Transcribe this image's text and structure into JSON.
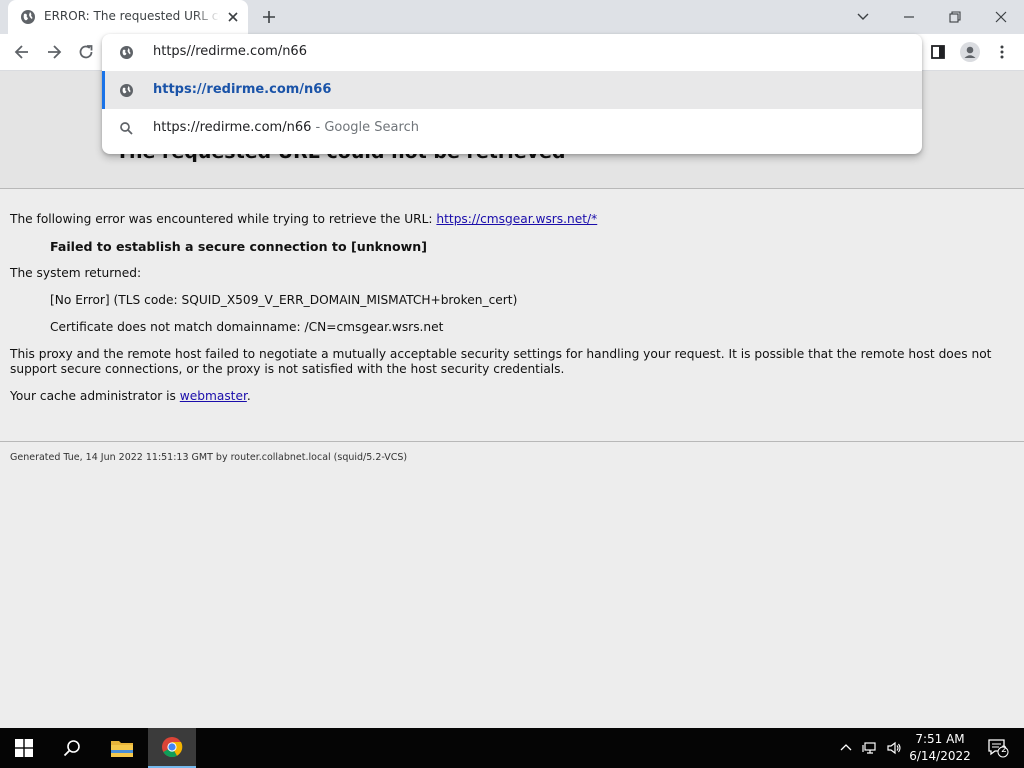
{
  "browser": {
    "tab_title": "ERROR: The requested URL could not be retrieved",
    "address_text": "https//redirme.com/n66",
    "suggestions": [
      {
        "text": "https://redirme.com/n66",
        "desc": "",
        "icon": "globe-icon"
      },
      {
        "text": "https://redirme.com/n66",
        "desc": " - Google Search",
        "icon": "search-icon"
      }
    ]
  },
  "page": {
    "heading": "The requested URL could not be retrieved",
    "intro": "The following error was encountered while trying to retrieve the URL: ",
    "url_link": "https://cmsgear.wsrs.net/*",
    "error_title": "Failed to establish a secure connection to [unknown]",
    "system_returned": "The system returned:",
    "tls_error": "[No Error] (TLS code: SQUID_X509_V_ERR_DOMAIN_MISMATCH+broken_cert)",
    "cert_error": "Certificate does not match domainname: /CN=cmsgear.wsrs.net",
    "explanation": "This proxy and the remote host failed to negotiate a mutually acceptable security settings for handling your request. It is possible that the remote host does not support secure connections, or the proxy is not satisfied with the host security credentials.",
    "cache_admin_prefix": "Your cache administrator is ",
    "cache_admin_link": "webmaster",
    "cache_admin_suffix": ".",
    "footer": "Generated Tue, 14 Jun 2022 11:51:13 GMT by router.collabnet.local (squid/5.2-VCS)"
  },
  "taskbar": {
    "time": "7:51 AM",
    "date": "6/14/2022",
    "notification_count": "2"
  },
  "colors": {
    "accent_blue": "#1a73e8",
    "link_blue": "#1a0dab",
    "taskbar_bg": "#050505"
  }
}
